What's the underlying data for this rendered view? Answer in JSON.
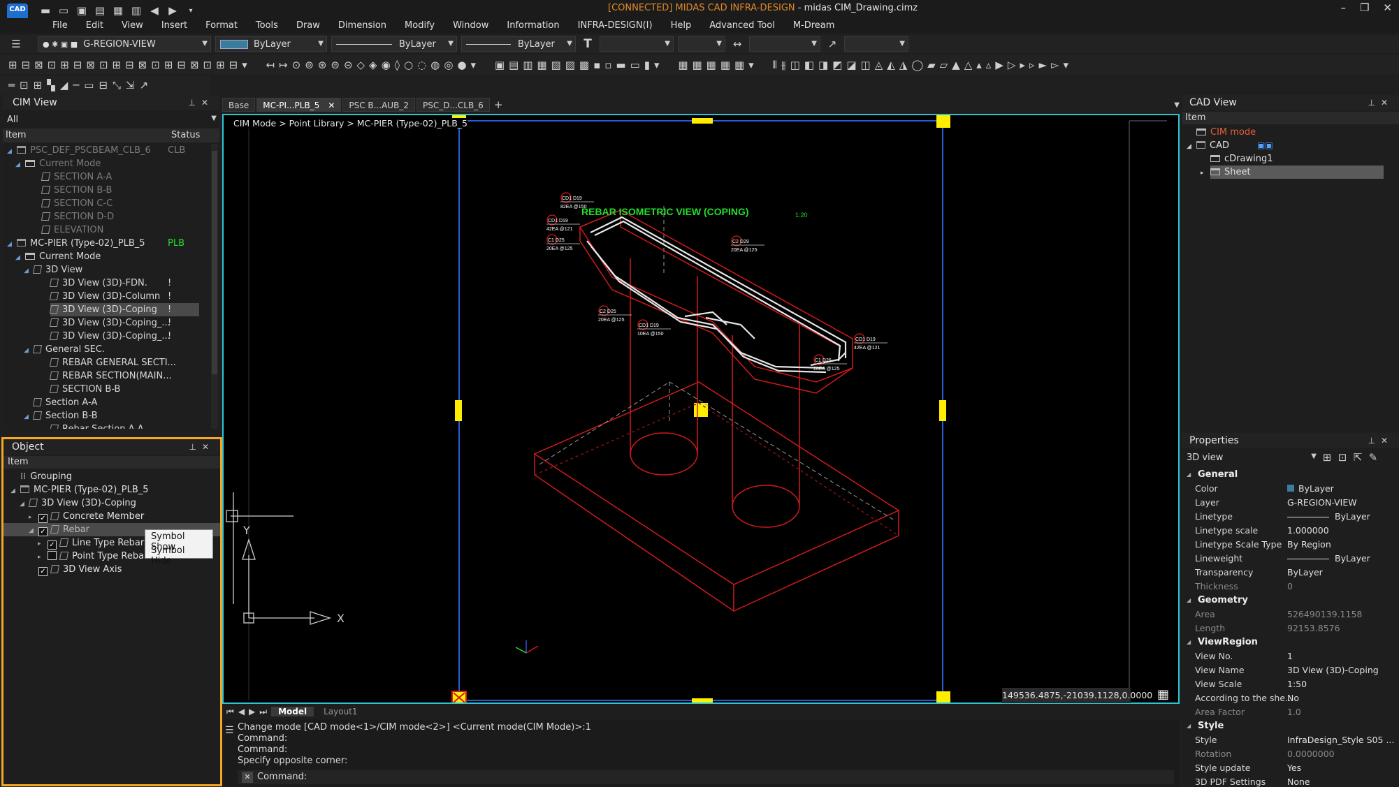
{
  "app": {
    "logo": "CAD",
    "title_status": "[CONNECTED] MIDAS CAD INFRA-DESIGN",
    "title_file": " - midas CIM_Drawing.cimz"
  },
  "menu": [
    "File",
    "Edit",
    "View",
    "Insert",
    "Format",
    "Tools",
    "Draw",
    "Dimension",
    "Modify",
    "Window",
    "Information",
    "INFRA-DESIGN(I)",
    "Help",
    "Advanced Tool",
    "M-Dream"
  ],
  "toolbar": {
    "layer": "G-REGION-VIEW",
    "color": "ByLayer",
    "linetype": "ByLayer",
    "lineweight": "ByLayer"
  },
  "cim_view": {
    "title": "CIM View",
    "filter": "All",
    "col_item": "Item",
    "col_status": "Status",
    "rows": [
      {
        "label": "PSC_DEF_PSCBEAM_CLB_6",
        "status": "CLB",
        "indent": 1,
        "icon": "sheet",
        "exp": "◢",
        "dim": true
      },
      {
        "label": "Current Mode",
        "status": "",
        "indent": 2,
        "icon": "folder",
        "exp": "◢",
        "dim": true
      },
      {
        "label": "SECTION A-A",
        "status": "",
        "indent": 4,
        "icon": "page",
        "exp": "",
        "dim": true
      },
      {
        "label": "SECTION B-B",
        "status": "",
        "indent": 4,
        "icon": "page",
        "exp": "",
        "dim": true
      },
      {
        "label": "SECTION C-C",
        "status": "",
        "indent": 4,
        "icon": "page",
        "exp": "",
        "dim": true
      },
      {
        "label": "SECTION D-D",
        "status": "",
        "indent": 4,
        "icon": "page",
        "exp": "",
        "dim": true
      },
      {
        "label": "ELEVATION",
        "status": "",
        "indent": 4,
        "icon": "page",
        "exp": "",
        "dim": true
      },
      {
        "label": "MC-PIER (Type-02)_PLB_5",
        "status": "PLB",
        "indent": 1,
        "icon": "sheet",
        "exp": "◢",
        "dim": false
      },
      {
        "label": "Current Mode",
        "status": "",
        "indent": 2,
        "icon": "folder",
        "exp": "◢",
        "dim": false
      },
      {
        "label": "3D View",
        "status": "",
        "indent": 3,
        "icon": "page",
        "exp": "◢",
        "dim": false
      },
      {
        "label": "3D View (3D)-FDN.",
        "status": "!",
        "indent": 5,
        "icon": "page",
        "exp": "",
        "dim": false
      },
      {
        "label": "3D View (3D)-Column",
        "status": "!",
        "indent": 5,
        "icon": "page",
        "exp": "",
        "dim": false
      },
      {
        "label": "3D View (3D)-Coping",
        "status": "!",
        "indent": 5,
        "icon": "page",
        "exp": "",
        "dim": false,
        "selected": true
      },
      {
        "label": "3D View (3D)-Coping_...",
        "status": "!",
        "indent": 5,
        "icon": "page",
        "exp": "",
        "dim": false
      },
      {
        "label": "3D View (3D)-Coping_...",
        "status": "!",
        "indent": 5,
        "icon": "page",
        "exp": "",
        "dim": false
      },
      {
        "label": "General SEC.",
        "status": "",
        "indent": 3,
        "icon": "page",
        "exp": "◢",
        "dim": false
      },
      {
        "label": "REBAR GENERAL SECTI...",
        "status": "",
        "indent": 5,
        "icon": "page",
        "exp": "",
        "dim": false
      },
      {
        "label": "REBAR SECTION(MAIN...",
        "status": "",
        "indent": 5,
        "icon": "page",
        "exp": "",
        "dim": false
      },
      {
        "label": "SECTION B-B",
        "status": "",
        "indent": 5,
        "icon": "page",
        "exp": "",
        "dim": false
      },
      {
        "label": "Section A-A",
        "status": "",
        "indent": 3,
        "icon": "page",
        "exp": "",
        "dim": false
      },
      {
        "label": "Section B-B",
        "status": "",
        "indent": 3,
        "icon": "page",
        "exp": "◢",
        "dim": false
      },
      {
        "label": "Rebar Section A-A",
        "status": "",
        "indent": 5,
        "icon": "page",
        "exp": "",
        "dim": false
      }
    ]
  },
  "object_panel": {
    "title": "Object",
    "col_item": "Item",
    "rows": [
      {
        "label": "Grouping",
        "indent": 0,
        "kind": "group",
        "exp": ""
      },
      {
        "label": "MC-PIER (Type-02)_PLB_5",
        "indent": 0,
        "kind": "sheet",
        "exp": "◢"
      },
      {
        "label": "3D View (3D)-Coping",
        "indent": 1,
        "kind": "page",
        "exp": "◢"
      },
      {
        "label": "Concrete Member",
        "indent": 2,
        "kind": "check",
        "exp": "▸"
      },
      {
        "label": "Rebar",
        "indent": 2,
        "kind": "check",
        "exp": "◢",
        "selected": true
      },
      {
        "label": "Line Type Rebar",
        "indent": 3,
        "kind": "check",
        "exp": "▸"
      },
      {
        "label": "Point Type Rebar",
        "indent": 3,
        "kind": "uncheck",
        "exp": "▸"
      },
      {
        "label": "3D View Axis",
        "indent": 2,
        "kind": "check",
        "exp": ""
      }
    ],
    "context_menu": [
      "Symbol Show",
      "Symbol Hide"
    ]
  },
  "doc_tabs": [
    "Base",
    "MC-PI...PLB_5",
    "PSC B...AUB_2",
    "PSC_D...CLB_6"
  ],
  "breadcrumb": "CIM Mode > Point Library > MC-PIER (Type-02)_PLB_5",
  "drawing": {
    "title": "REBAR ISOMETRIC VIEW (COPING)",
    "scale_note": "1:20",
    "labels": [
      {
        "top": "CD1  D19",
        "bot": "82EA @150"
      },
      {
        "top": "CD1  D19",
        "bot": "42EA @121"
      },
      {
        "top": "C1  D25",
        "bot": "20EA @125"
      },
      {
        "top": "C2  D29",
        "bot": "20EA @125"
      },
      {
        "top": "C2  D25",
        "bot": "20EA @125"
      },
      {
        "top": "CD1  D19",
        "bot": "10EA @150"
      },
      {
        "top": "CD1  D19",
        "bot": "42EA @121"
      },
      {
        "top": "C1  D25",
        "bot": "20EA @125"
      }
    ]
  },
  "ucs": {
    "x": "X",
    "y": "Y"
  },
  "coords": "149536.4875,-21039.1128,0.0000",
  "layout_tabs": [
    "Model",
    "Layout1"
  ],
  "command_history": [
    "Change mode [CAD mode<1>/CIM mode<2>] <Current mode(CIM Mode)>:1",
    "Command:",
    "Command:",
    "Specify opposite corner:"
  ],
  "command_prompt": "Command:",
  "cad_view": {
    "title": "CAD View",
    "col_item": "Item",
    "rows": [
      {
        "label": "CIM mode",
        "indent": 0,
        "icon": "folder",
        "exp": "",
        "accent": true
      },
      {
        "label": "CAD",
        "indent": 0,
        "icon": "sheet",
        "exp": "◢"
      },
      {
        "label": "cDrawing1",
        "indent": 1,
        "icon": "folder",
        "exp": ""
      },
      {
        "label": "Sheet",
        "indent": 1,
        "icon": "folder",
        "exp": "▸",
        "selected": true
      }
    ]
  },
  "properties": {
    "title": "Properties",
    "selector": "3D view",
    "sections": [
      {
        "name": "General",
        "rows": [
          {
            "k": "Color",
            "v": "ByLayer",
            "swatch": true
          },
          {
            "k": "Layer",
            "v": "G-REGION-VIEW"
          },
          {
            "k": "Linetype",
            "v": "ByLayer",
            "line": true
          },
          {
            "k": "Linetype scale",
            "v": "1.000000"
          },
          {
            "k": "Linetype Scale Type",
            "v": "By Region"
          },
          {
            "k": "Lineweight",
            "v": "ByLayer",
            "line": true
          },
          {
            "k": "Transparency",
            "v": "ByLayer"
          },
          {
            "k": "Thickness",
            "v": "0",
            "dim": true
          }
        ]
      },
      {
        "name": "Geometry",
        "rows": [
          {
            "k": "Area",
            "v": "526490139.1158",
            "dim": true
          },
          {
            "k": "Length",
            "v": "92153.8576",
            "dim": true
          }
        ]
      },
      {
        "name": "ViewRegion",
        "rows": [
          {
            "k": "View No.",
            "v": "1"
          },
          {
            "k": "View Name",
            "v": "3D View (3D)-Coping"
          },
          {
            "k": "View Scale",
            "v": "1:50"
          },
          {
            "k": "According to the she...",
            "v": "No"
          },
          {
            "k": "Area Factor",
            "v": "1.0",
            "dim": true
          }
        ]
      },
      {
        "name": "Style",
        "rows": [
          {
            "k": "Style",
            "v": "InfraDesign_Style S05 ..."
          },
          {
            "k": "Rotation",
            "v": "0.0000000",
            "dim": true
          },
          {
            "k": "Style update",
            "v": "Yes"
          },
          {
            "k": "3D PDF Settings",
            "v": "None"
          }
        ]
      }
    ]
  },
  "colors": {
    "accent_orange": "#f5a623",
    "cad_red": "#d11a1a",
    "title_green": "#22e02a",
    "grip_yellow": "#ffee00",
    "viewport_blue": "#2a5bd7",
    "frame_cyan": "#2ec5d3"
  }
}
